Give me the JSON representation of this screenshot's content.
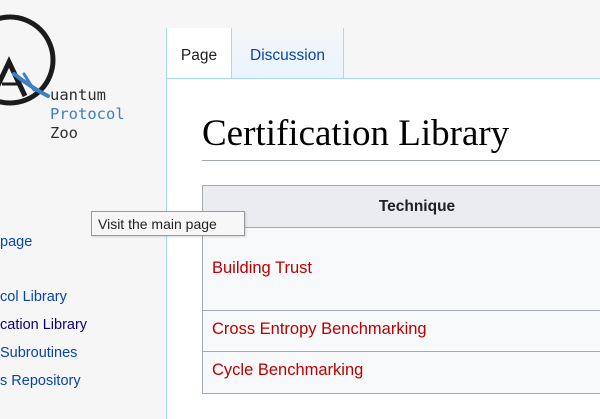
{
  "logo": {
    "line1": "uantum",
    "line2": "Protocol",
    "line3": "Zoo"
  },
  "sidebar": {
    "items": [
      {
        "label": "page"
      },
      {
        "label": "col Library"
      },
      {
        "label": "cation Library"
      },
      {
        "label": " Subroutines"
      },
      {
        "label": "s Repository"
      }
    ]
  },
  "tabs": [
    {
      "label": "Page"
    },
    {
      "label": "Discussion"
    }
  ],
  "page": {
    "title": "Certification Library"
  },
  "table": {
    "header": "Technique",
    "rows": [
      {
        "label": "Building Trust"
      },
      {
        "label": "Cross Entropy Benchmarking"
      },
      {
        "label": "Cycle Benchmarking"
      }
    ]
  },
  "tooltip": {
    "text": "Visit the main page"
  },
  "colors": {
    "link": "#0645ad",
    "visited": "#0b0080",
    "redlink": "#ba0000",
    "tab_border": "#a7d7f9"
  }
}
